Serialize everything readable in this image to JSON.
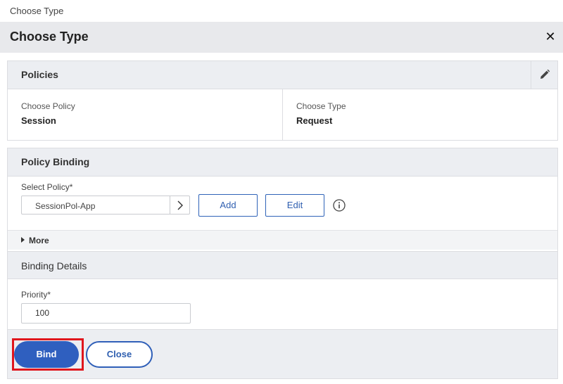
{
  "breadcrumb": "Choose Type",
  "dialog": {
    "title": "Choose Type",
    "close_icon": "close-icon"
  },
  "policies": {
    "header": "Policies",
    "edit_icon": "pencil-icon",
    "choose_policy_label": "Choose Policy",
    "choose_policy_value": "Session",
    "choose_type_label": "Choose Type",
    "choose_type_value": "Request"
  },
  "policy_binding": {
    "header": "Policy Binding",
    "select_policy_label": "Select Policy*",
    "select_policy_value": "SessionPol-App",
    "add_label": "Add",
    "edit_label": "Edit",
    "info_icon": "info-icon"
  },
  "more": {
    "label": "More"
  },
  "binding_details": {
    "header": "Binding Details",
    "priority_label": "Priority*",
    "priority_value": "100"
  },
  "footer": {
    "bind_label": "Bind",
    "close_label": "Close"
  },
  "colors": {
    "accent": "#2f5fbf",
    "highlight": "#e0161d",
    "header_bg": "#eceef2"
  }
}
